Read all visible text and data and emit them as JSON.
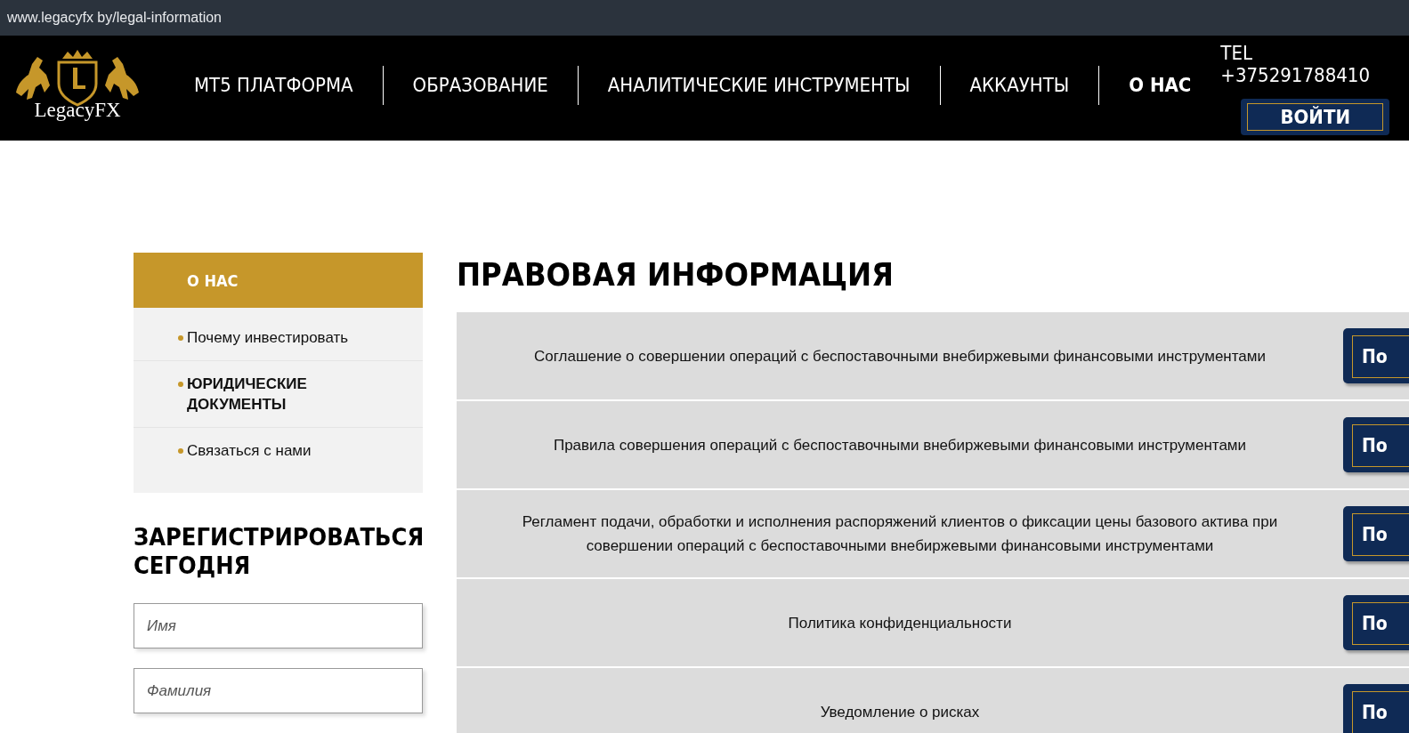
{
  "address_bar": {
    "url": "www.legacyfx by/legal-information"
  },
  "header": {
    "logo_text": "LegacyFX",
    "phone": "TEL +375291788410",
    "login_button": "ВОЙТИ",
    "nav": [
      {
        "label": "MT5 ПЛАТФОРМА",
        "selected": false
      },
      {
        "label": "ОБРАЗОВАНИЕ",
        "selected": false
      },
      {
        "label": "АНАЛИТИЧЕСКИЕ ИНСТРУМЕНТЫ",
        "selected": false
      },
      {
        "label": "АККАУНТЫ",
        "selected": false
      },
      {
        "label": "О НАС",
        "selected": true
      }
    ]
  },
  "sidebar": {
    "title": "О НАС",
    "items": [
      {
        "label": "Почему инвестировать",
        "selected": false
      },
      {
        "label": "ЮРИДИЧЕСКИЕ ДОКУМЕНТЫ",
        "selected": true
      },
      {
        "label": "Связаться с нами",
        "selected": false
      }
    ]
  },
  "register": {
    "title": "ЗАРЕГИСТРИРОВАТЬСЯ СЕГОДНЯ",
    "fields": [
      {
        "placeholder": "Имя"
      },
      {
        "placeholder": "Фамилия"
      }
    ]
  },
  "main": {
    "title": "ПРАВОВАЯ ИНФОРМАЦИЯ",
    "documents": [
      {
        "title": "Соглашение о совершении операций с беспоставочными внебиржевыми финансовыми инструментами",
        "button": "По"
      },
      {
        "title": "Правила совершения операций с беспоставочными внебиржевыми финансовыми инструментами",
        "button": "По"
      },
      {
        "title": "Регламент подачи, обработки и исполнения распоряжений клиентов о фиксации цены базового актива при совершении операций с беспоставочными внебиржевыми финансовыми инструментами",
        "button": "По"
      },
      {
        "title": "Политика конфиденциальности",
        "button": "По"
      },
      {
        "title": "Уведомление о рисках",
        "button": "По"
      }
    ]
  }
}
